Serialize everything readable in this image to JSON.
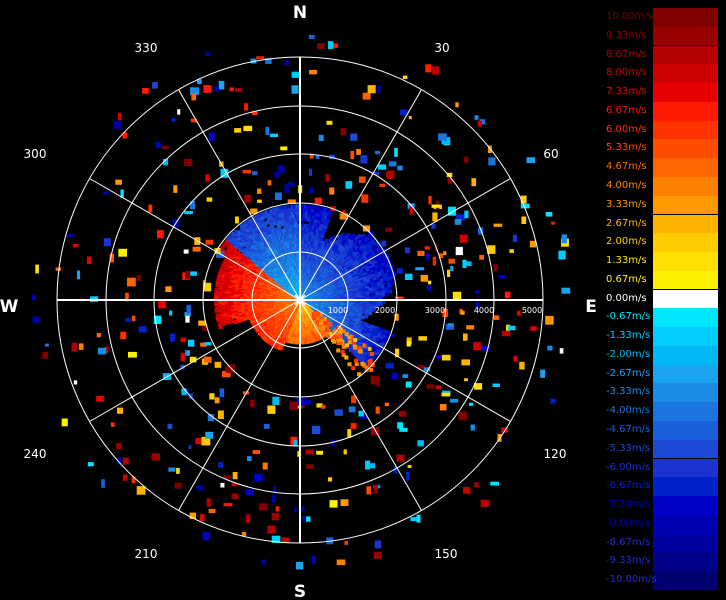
{
  "radar": {
    "compass": {
      "north": "N",
      "east": "E",
      "south": "S",
      "west": "W"
    },
    "bearings": [
      {
        "deg": 30,
        "label": "30"
      },
      {
        "deg": 60,
        "label": "60"
      },
      {
        "deg": 120,
        "label": "120"
      },
      {
        "deg": 150,
        "label": "150"
      },
      {
        "deg": 210,
        "label": "210"
      },
      {
        "deg": 240,
        "label": "240"
      },
      {
        "deg": 300,
        "label": "300"
      },
      {
        "deg": 330,
        "label": "330"
      }
    ],
    "range_rings": [
      "1000",
      "2000",
      "3000",
      "4000",
      "5000"
    ],
    "colors": {
      "grid": "#ffffff",
      "background": "#000000"
    }
  },
  "legend": {
    "entries": [
      {
        "label": "10.00m/s",
        "color": "#800000"
      },
      {
        "label": "9.33m/s",
        "color": "#990000"
      },
      {
        "label": "8.67m/s",
        "color": "#b30000"
      },
      {
        "label": "8.00m/s",
        "color": "#cc0000"
      },
      {
        "label": "7.33m/s",
        "color": "#e60000"
      },
      {
        "label": "6.67m/s",
        "color": "#ff1a00"
      },
      {
        "label": "6.00m/s",
        "color": "#ff3300"
      },
      {
        "label": "5.33m/s",
        "color": "#ff4d00"
      },
      {
        "label": "4.67m/s",
        "color": "#ff6600"
      },
      {
        "label": "4.00m/s",
        "color": "#ff8000"
      },
      {
        "label": "3.33m/s",
        "color": "#ff9900"
      },
      {
        "label": "2.67m/s",
        "color": "#ffb300"
      },
      {
        "label": "2.00m/s",
        "color": "#ffcc00"
      },
      {
        "label": "1.33m/s",
        "color": "#ffe000"
      },
      {
        "label": "0.67m/s",
        "color": "#fff000"
      },
      {
        "label": "0.00m/s",
        "color": "#ffffff"
      },
      {
        "label": "-0.67m/s",
        "color": "#00e5ff"
      },
      {
        "label": "-1.33m/s",
        "color": "#00ccff"
      },
      {
        "label": "-2.00m/s",
        "color": "#00b8f5"
      },
      {
        "label": "-2.67m/s",
        "color": "#1aa3ee"
      },
      {
        "label": "-3.33m/s",
        "color": "#1a8ce6"
      },
      {
        "label": "-4.00m/s",
        "color": "#1a75e0"
      },
      {
        "label": "-4.67m/s",
        "color": "#1a5fdb"
      },
      {
        "label": "-5.33m/s",
        "color": "#1a4ad6"
      },
      {
        "label": "-6.00m/s",
        "color": "#1a33d1"
      },
      {
        "label": "-6.67m/s",
        "color": "#0022cc"
      },
      {
        "label": "-7.33m/s",
        "color": "#0000c8"
      },
      {
        "label": "-8.00m/s",
        "color": "#0000b3"
      },
      {
        "label": "-8.67m/s",
        "color": "#00009e"
      },
      {
        "label": "-9.33m/s",
        "color": "#000088"
      },
      {
        "label": "-10.00m/s",
        "color": "#000070"
      }
    ]
  }
}
